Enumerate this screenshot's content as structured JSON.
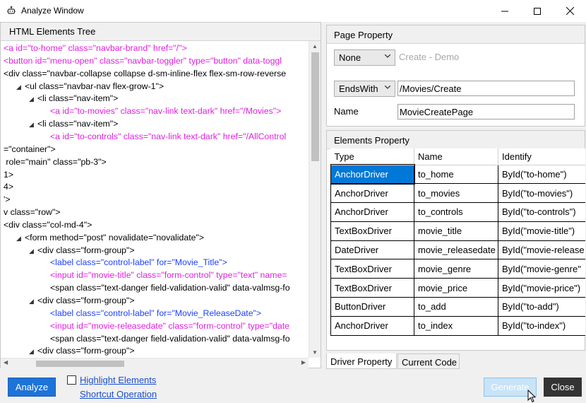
{
  "window": {
    "title": "Analyze Window",
    "app_icon": "robot-icon",
    "controls": [
      "minimize-icon",
      "maximize-icon",
      "close-icon"
    ]
  },
  "left_panel": {
    "header": "HTML Elements Tree",
    "lines": [
      {
        "indent": 0,
        "arrow": "",
        "color": "pink",
        "text": "<a id=\"to-home\" class=\"navbar-brand\" href=\"/\">"
      },
      {
        "indent": 0,
        "arrow": "",
        "color": "pink",
        "text": "<button id=\"menu-open\" class=\"navbar-toggler\" type=\"button\" data-toggl"
      },
      {
        "indent": 0,
        "arrow": "",
        "color": "black",
        "text": "<div class=\"navbar-collapse collapse d-sm-inline-flex flex-sm-row-reverse"
      },
      {
        "indent": 1,
        "arrow": "◢",
        "color": "black",
        "text": "<ul class=\"navbar-nav flex-grow-1\">"
      },
      {
        "indent": 2,
        "arrow": "◢",
        "color": "black",
        "text": "<li class=\"nav-item\">"
      },
      {
        "indent": 3,
        "arrow": "",
        "color": "pink",
        "text": "<a id=\"to-movies\" class=\"nav-link text-dark\" href=\"/Movies\">"
      },
      {
        "indent": 2,
        "arrow": "◢",
        "color": "black",
        "text": "<li class=\"nav-item\">"
      },
      {
        "indent": 3,
        "arrow": "",
        "color": "pink",
        "text": "<a id=\"to-controls\" class=\"nav-link text-dark\" href=\"/AllControl"
      },
      {
        "indent": 0,
        "arrow": "",
        "color": "black",
        "text": "=\"container\">"
      },
      {
        "indent": 0,
        "arrow": "",
        "color": "black",
        "text": " role=\"main\" class=\"pb-3\">"
      },
      {
        "indent": 0,
        "arrow": "",
        "color": "black",
        "text": "1>"
      },
      {
        "indent": 0,
        "arrow": "",
        "color": "black",
        "text": "4>"
      },
      {
        "indent": 0,
        "arrow": "",
        "color": "black",
        "text": "'>"
      },
      {
        "indent": 0,
        "arrow": "",
        "color": "black",
        "text": "v class=\"row\">"
      },
      {
        "indent": 0,
        "arrow": "",
        "color": "black",
        "text": "<div class=\"col-md-4\">"
      },
      {
        "indent": 1,
        "arrow": "◢",
        "color": "black",
        "text": "<form method=\"post\" novalidate=\"novalidate\">"
      },
      {
        "indent": 2,
        "arrow": "◢",
        "color": "black",
        "text": "<div class=\"form-group\">"
      },
      {
        "indent": 3,
        "arrow": "",
        "color": "blue",
        "text": "<label class=\"control-label\" for=\"Movie_Title\">"
      },
      {
        "indent": 3,
        "arrow": "",
        "color": "pink",
        "text": "<input id=\"movie-title\" class=\"form-control\" type=\"text\" name="
      },
      {
        "indent": 3,
        "arrow": "",
        "color": "black",
        "text": "<span class=\"text-danger field-validation-valid\" data-valmsg-fo"
      },
      {
        "indent": 2,
        "arrow": "◢",
        "color": "black",
        "text": "<div class=\"form-group\">"
      },
      {
        "indent": 3,
        "arrow": "",
        "color": "blue",
        "text": "<label class=\"control-label\" for=\"Movie_ReleaseDate\">"
      },
      {
        "indent": 3,
        "arrow": "",
        "color": "pink",
        "text": "<input id=\"movie-releasedate\" class=\"form-control\" type=\"date"
      },
      {
        "indent": 3,
        "arrow": "",
        "color": "black",
        "text": "<span class=\"text-danger field-validation-valid\" data-valmsg-fo"
      },
      {
        "indent": 2,
        "arrow": "◢",
        "color": "black",
        "text": "<div class=\"form-group\">"
      }
    ]
  },
  "page_property": {
    "header": "Page Property",
    "title_mode": "None",
    "title_value": "Create - Demo",
    "url_mode": "EndsWith",
    "url_value": "/Movies/Create",
    "name_label": "Name",
    "name_value": "MovieCreatePage"
  },
  "elements_property": {
    "header": "Elements Property",
    "columns": [
      "Type",
      "Name",
      "Identify"
    ],
    "rows": [
      {
        "type": "AnchorDriver",
        "name": "to_home",
        "identify": "ById(\"to-home\")"
      },
      {
        "type": "AnchorDriver",
        "name": "to_movies",
        "identify": "ById(\"to-movies\")"
      },
      {
        "type": "AnchorDriver",
        "name": "to_controls",
        "identify": "ById(\"to-controls\")"
      },
      {
        "type": "TextBoxDriver",
        "name": "movie_title",
        "identify": "ById(\"movie-title\")"
      },
      {
        "type": "DateDriver",
        "name": "movie_releasedate",
        "identify": "ById(\"movie-release"
      },
      {
        "type": "TextBoxDriver",
        "name": "movie_genre",
        "identify": "ById(\"movie-genre\""
      },
      {
        "type": "TextBoxDriver",
        "name": "movie_price",
        "identify": "ById(\"movie-price\")"
      },
      {
        "type": "ButtonDriver",
        "name": "to_add",
        "identify": "ById(\"to-add\")"
      },
      {
        "type": "AnchorDriver",
        "name": "to_index",
        "identify": "ById(\"to-index\")"
      }
    ]
  },
  "tabs": [
    "Driver Property",
    "Current Code"
  ],
  "footer": {
    "analyze": "Analyze",
    "highlight": "Highlight Elements",
    "shortcut": "Shortcut Operation",
    "generate": "Generate",
    "close": "Close"
  },
  "colors": {
    "pink": "#e020e0",
    "blue": "#1e40ff",
    "accent": "#0078d7",
    "analyze": "#1e73d8",
    "close": "#333333"
  }
}
